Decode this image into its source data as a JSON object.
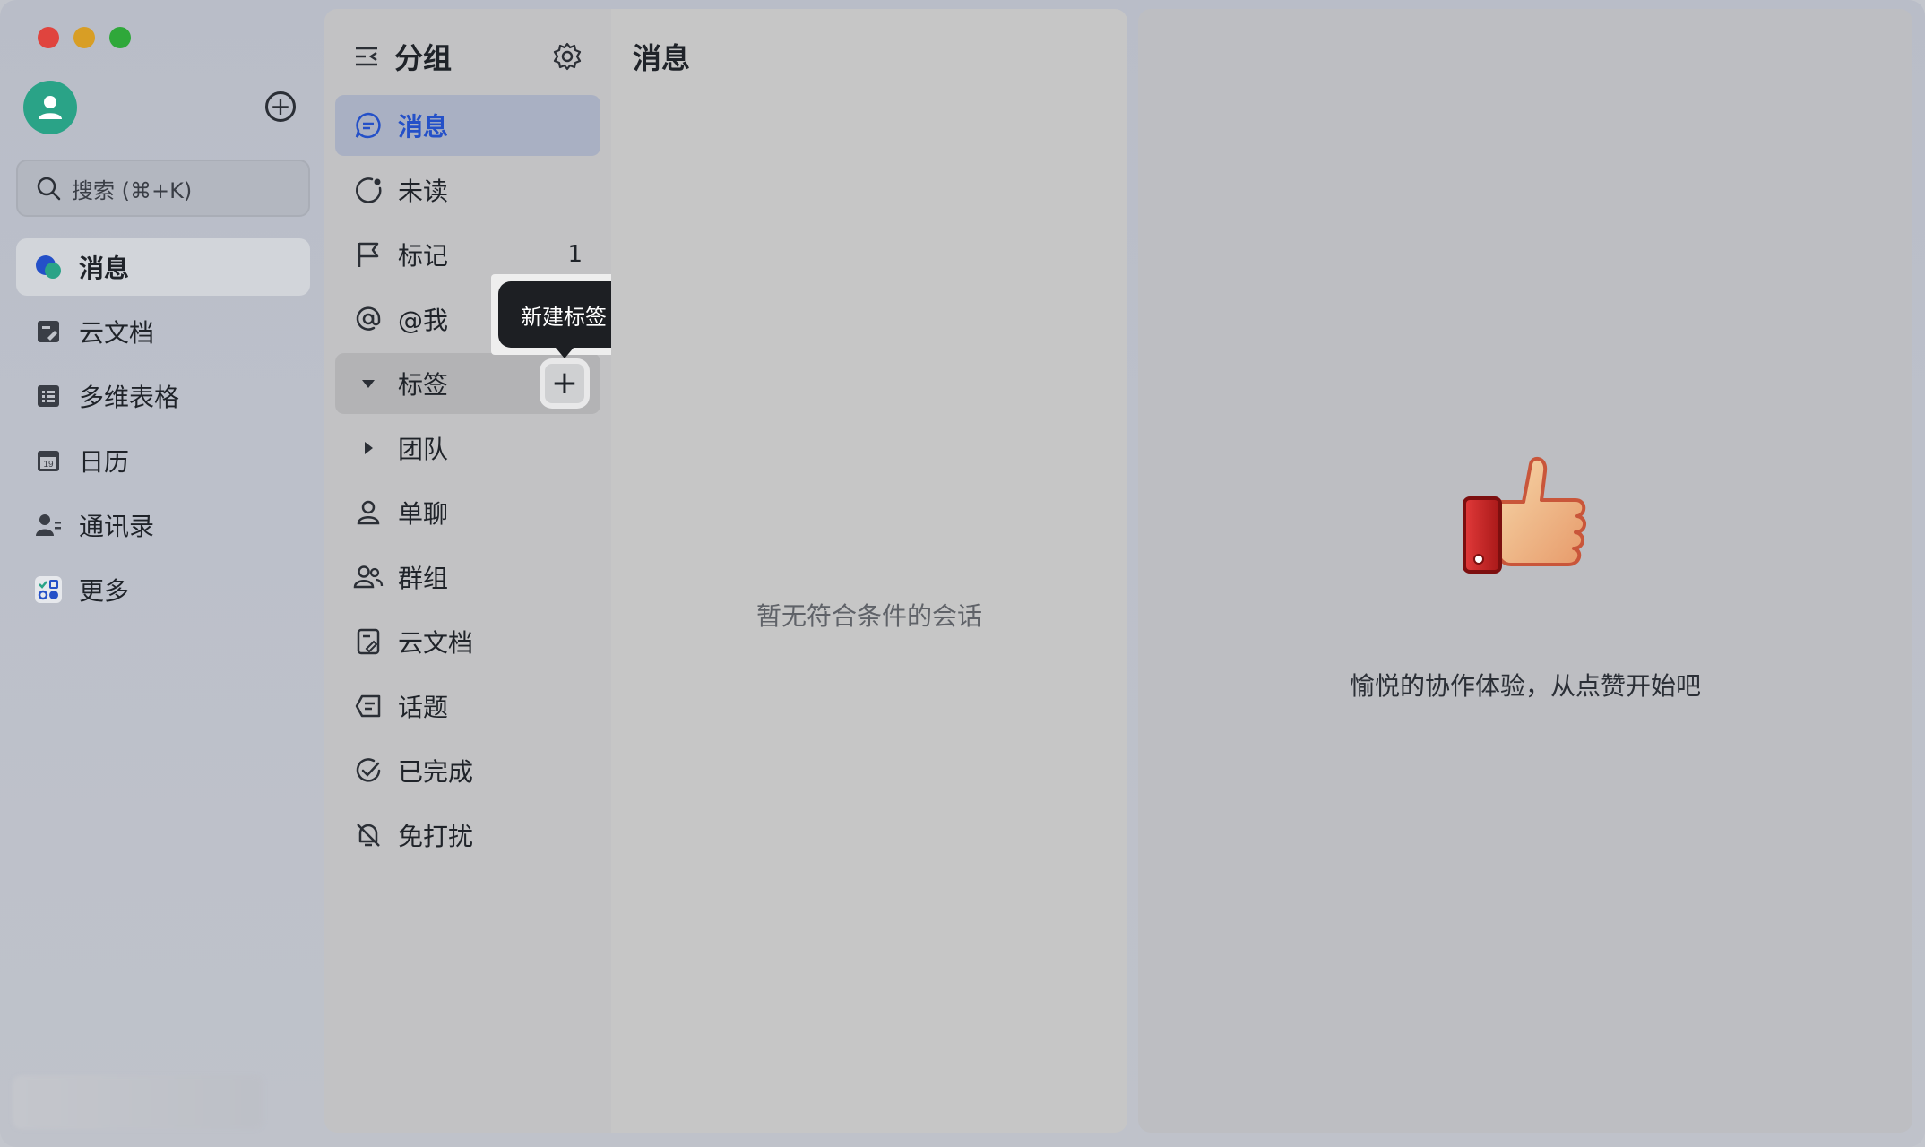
{
  "sidebar": {
    "search_placeholder": "搜索 (⌘+K)",
    "items": [
      {
        "label": "消息",
        "icon": "chat-bubbles-icon",
        "active": true
      },
      {
        "label": "云文档",
        "icon": "cloud-doc-icon"
      },
      {
        "label": "多维表格",
        "icon": "table-icon"
      },
      {
        "label": "日历",
        "icon": "calendar-icon",
        "day": "19"
      },
      {
        "label": "通讯录",
        "icon": "contacts-icon"
      },
      {
        "label": "更多",
        "icon": "more-apps-icon"
      }
    ]
  },
  "group_panel": {
    "title": "分组",
    "items": [
      {
        "label": "消息",
        "icon": "message-icon",
        "active": true
      },
      {
        "label": "未读",
        "icon": "unread-icon"
      },
      {
        "label": "标记",
        "icon": "flag-icon",
        "count": "1"
      },
      {
        "label": "@我",
        "icon": "at-icon"
      },
      {
        "label": "标签",
        "icon": "caret-down-icon"
      },
      {
        "label": "团队",
        "icon": "caret-right-icon"
      },
      {
        "label": "单聊",
        "icon": "person-icon"
      },
      {
        "label": "群组",
        "icon": "group-icon"
      },
      {
        "label": "云文档",
        "icon": "doc-icon"
      },
      {
        "label": "话题",
        "icon": "topic-icon"
      },
      {
        "label": "已完成",
        "icon": "done-icon"
      },
      {
        "label": "免打扰",
        "icon": "mute-icon"
      }
    ],
    "tooltip": "新建标签"
  },
  "message_panel": {
    "title": "消息",
    "empty_text": "暂无符合条件的会话"
  },
  "right_panel": {
    "caption": "愉悦的协作体验，从点赞开始吧"
  },
  "colors": {
    "accent": "#2450c8",
    "avatar": "#2aa387"
  }
}
